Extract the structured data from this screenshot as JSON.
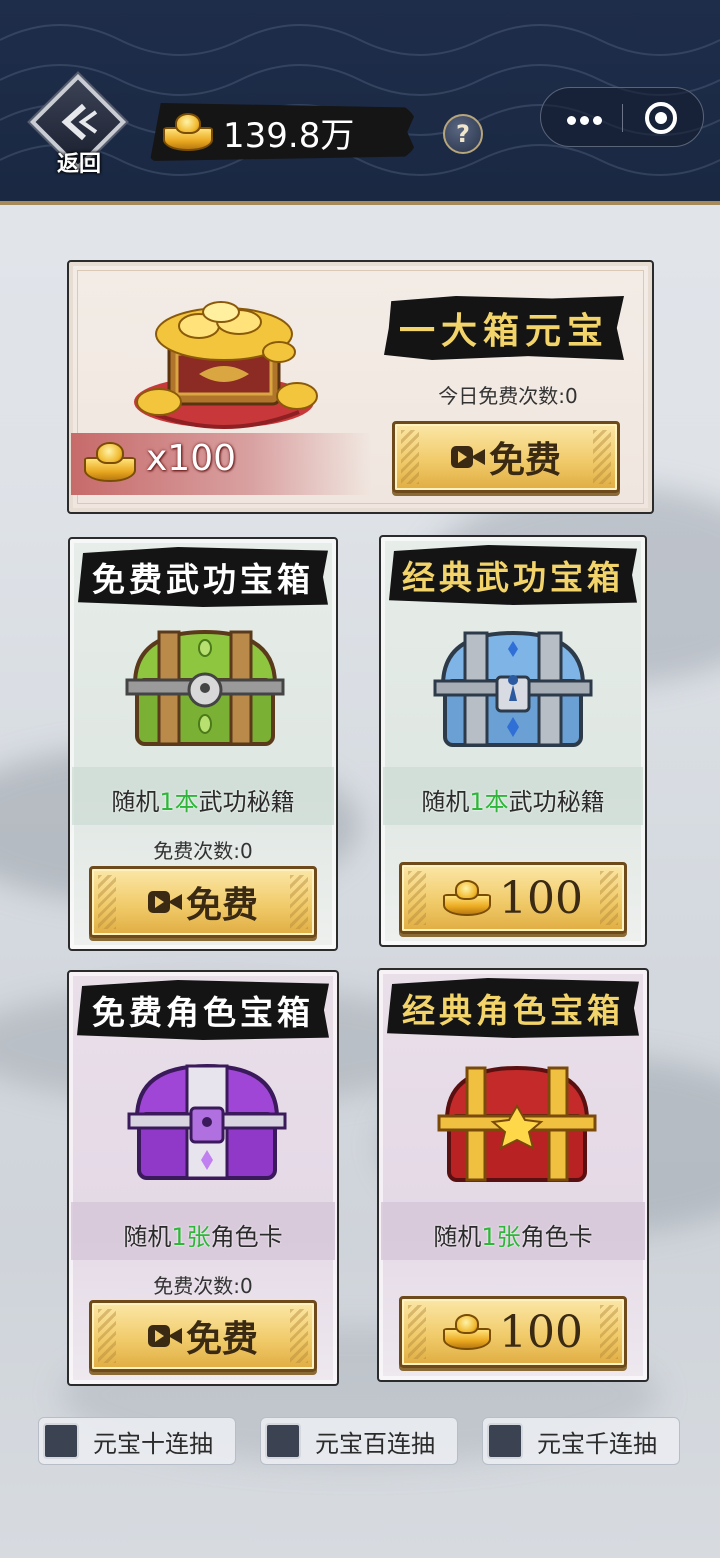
{
  "header": {
    "back_label": "返回",
    "gold_amount": "139.8万",
    "help_symbol": "?"
  },
  "featured": {
    "title": "一大箱元宝",
    "reward_count": "x100",
    "free_count_text": "今日免费次数:0",
    "button_label": "免费"
  },
  "cards": [
    {
      "title": "免费武功宝箱",
      "desc_prefix": "随机",
      "desc_highlight": "1本",
      "desc_suffix": "武功秘籍",
      "free_count_text": "免费次数:0",
      "button_label": "免费"
    },
    {
      "title": "经典武功宝箱",
      "desc_prefix": "随机",
      "desc_highlight": "1本",
      "desc_suffix": "武功秘籍",
      "price": "100"
    },
    {
      "title": "免费角色宝箱",
      "desc_prefix": "随机",
      "desc_highlight": "1张",
      "desc_suffix": "角色卡",
      "free_count_text": "免费次数:0",
      "button_label": "免费"
    },
    {
      "title": "经典角色宝箱",
      "desc_prefix": "随机",
      "desc_highlight": "1张",
      "desc_suffix": "角色卡",
      "price": "100"
    }
  ],
  "multi_pull": [
    {
      "label": "元宝十连抽",
      "checked": false
    },
    {
      "label": "元宝百连抽",
      "checked": false
    },
    {
      "label": "元宝千连抽",
      "checked": false
    }
  ],
  "colors": {
    "header_bg": "#1e2d4a",
    "gold_text": "#f2d46a",
    "highlight_green": "#2fb63a",
    "button_gold": "#f1cb6b"
  }
}
